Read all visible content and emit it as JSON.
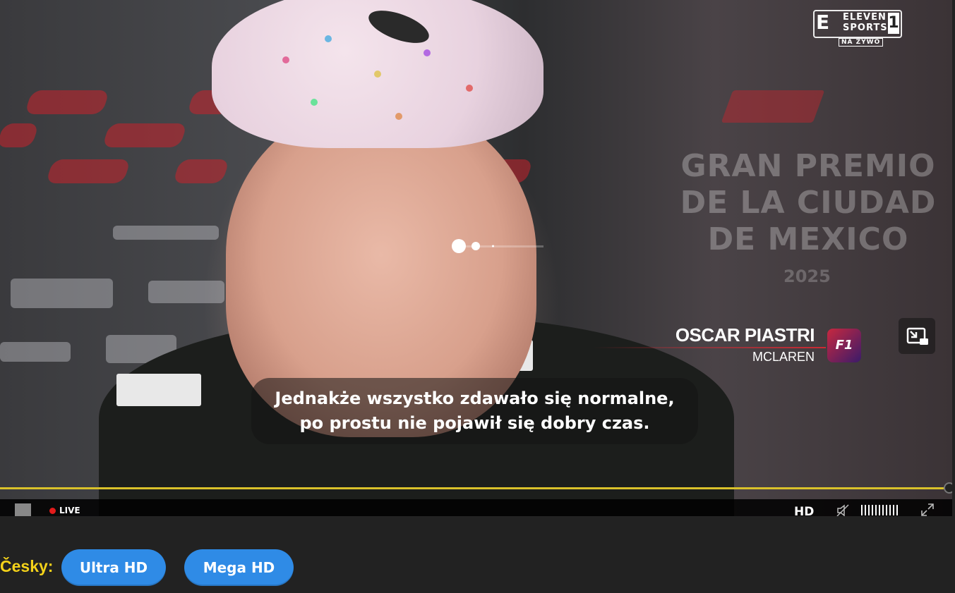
{
  "player": {
    "channel": {
      "brand_top": "ELEVEN",
      "brand_bottom": "SPORTS",
      "number": "1",
      "badge": "NA ŻYWO"
    },
    "lower_third": {
      "name": "OSCAR PIASTRI",
      "team": "MCLAREN",
      "series_badge": "F1"
    },
    "subtitle": {
      "line1": "Jednakże wszystko zdawało się normalne,",
      "line2": "po prostu nie pojawił się dobry czas."
    },
    "background_text": {
      "title": "GRAN PREMIO DE LA CIUDAD DE MEXICO",
      "year": "2025"
    },
    "progress_fraction": 1.0,
    "controls": {
      "live_label": "LIVE",
      "quality_label": "HD",
      "volume_icon": "speaker-muted-icon",
      "fullscreen_icon": "expand-icon",
      "pip_icon": "picture-in-picture-icon"
    },
    "colors": {
      "progress": "#d9c12a",
      "live_dot": "#e21b1b"
    }
  },
  "stream_options": {
    "language_label": "Česky:",
    "buttons": [
      "Ultra HD",
      "Mega HD"
    ],
    "button_color": "#2f8be6",
    "label_color": "#f4d21a"
  }
}
